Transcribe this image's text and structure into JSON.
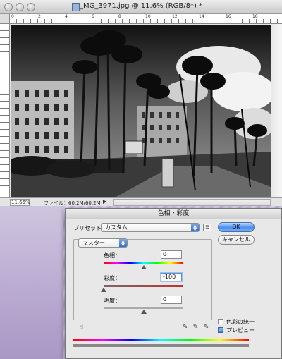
{
  "document": {
    "title": "_MG_3971.jpg @ 11.6% (RGB/8*) *",
    "ruler_labels": [
      "0",
      "2",
      "4",
      "6",
      "8",
      "10",
      "12",
      "14",
      "16",
      "18"
    ],
    "zoom": "11.65%",
    "file_info": "ファイル：60.2M/60.2M"
  },
  "dialog": {
    "title": "色相・彩度",
    "preset_label": "プリセット：",
    "preset_value": "カスタム",
    "ok_label": "OK",
    "cancel_label": "キャンセル",
    "channel_value": "マスター",
    "hue_label": "色相：",
    "hue_value": "0",
    "saturation_label": "彩度：",
    "saturation_value": "-100",
    "lightness_label": "明度：",
    "lightness_value": "0",
    "colorize_label": "色彩の統一",
    "preview_label": "プレビュー",
    "colorize_checked": false,
    "preview_checked": true,
    "hue_level": 0.5,
    "saturation_level": 0.0,
    "lightness_level": 0.5
  },
  "icons": {
    "preset_options": "preset-options-icon",
    "hand_adjust": "targeted-adjustment-icon",
    "eyedropper": "eyedropper-icon",
    "eyedropper_plus": "eyedropper-plus-icon",
    "eyedropper_minus": "eyedropper-minus-icon"
  }
}
